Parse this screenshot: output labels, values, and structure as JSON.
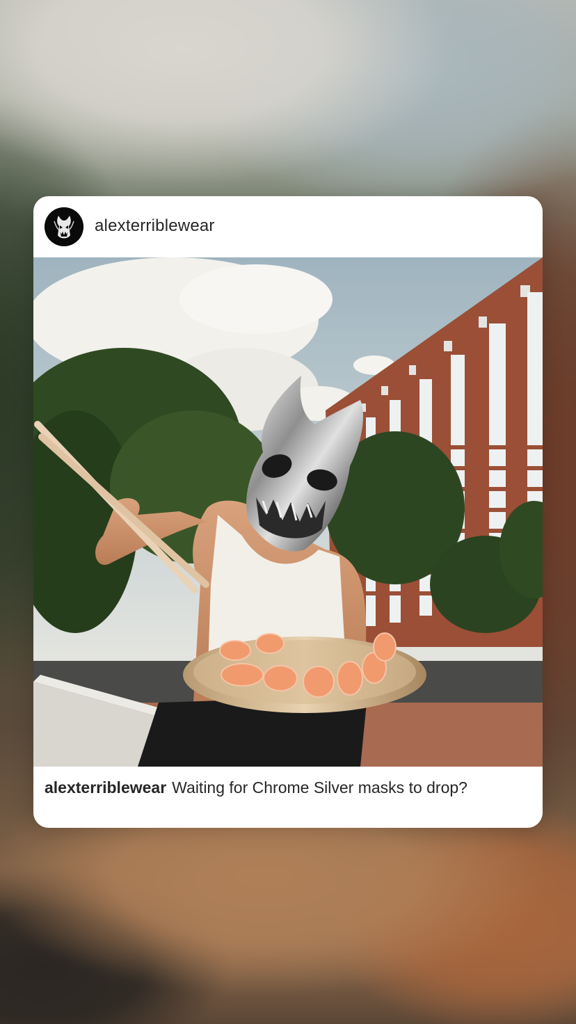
{
  "post": {
    "username": "alexterriblewear",
    "caption_user": "alexterriblewear",
    "caption_text": "Waiting for Chrome Silver masks to drop?"
  },
  "icons": {
    "avatar": "demon-mask-avatar-icon"
  },
  "colors": {
    "card_background": "#ffffff",
    "text": "#262626",
    "avatar_background": "#0a0a0a"
  }
}
